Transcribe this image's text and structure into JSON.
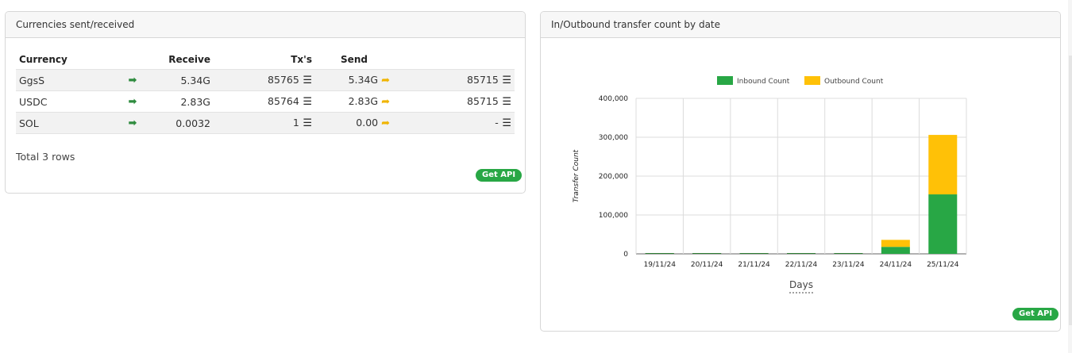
{
  "left_panel": {
    "title": "Currencies sent/received",
    "columns": [
      "Currency",
      "Receive",
      "Tx's",
      "Send"
    ],
    "rows": [
      {
        "currency": "GgsS",
        "receive": "5.34G",
        "tx_in": "85765",
        "send": "5.34G",
        "tx_out": "85715"
      },
      {
        "currency": "USDC",
        "receive": "2.83G",
        "tx_in": "85764",
        "send": "2.83G",
        "tx_out": "85715"
      },
      {
        "currency": "SOL",
        "receive": "0.0032",
        "tx_in": "1",
        "send": "0.00",
        "tx_out": "-"
      }
    ],
    "total_text": "Total 3 rows",
    "api_button": "Get API"
  },
  "right_panel": {
    "title": "In/Outbound transfer count by date",
    "api_button": "Get API"
  },
  "icons": {
    "receive": "sign-in-icon",
    "send": "sign-out-icon",
    "list": "list-icon"
  },
  "chart_data": {
    "type": "bar",
    "stacked": true,
    "categories": [
      "19/11/24",
      "20/11/24",
      "21/11/24",
      "22/11/24",
      "23/11/24",
      "24/11/24",
      "25/11/24"
    ],
    "series": [
      {
        "name": "Inbound Count",
        "color": "#28a745",
        "values": [
          0,
          0,
          0,
          0,
          0,
          18000,
          153000
        ]
      },
      {
        "name": "Outbound Count",
        "color": "#ffc107",
        "values": [
          0,
          0,
          0,
          0,
          0,
          18000,
          153000
        ]
      }
    ],
    "xlabel": "Days",
    "ylabel": "Transfer Count",
    "ylim": [
      0,
      400000
    ],
    "yticks": [
      "0",
      "100,000",
      "200,000",
      "300,000",
      "400,000"
    ],
    "grid": true,
    "legend": "top"
  }
}
